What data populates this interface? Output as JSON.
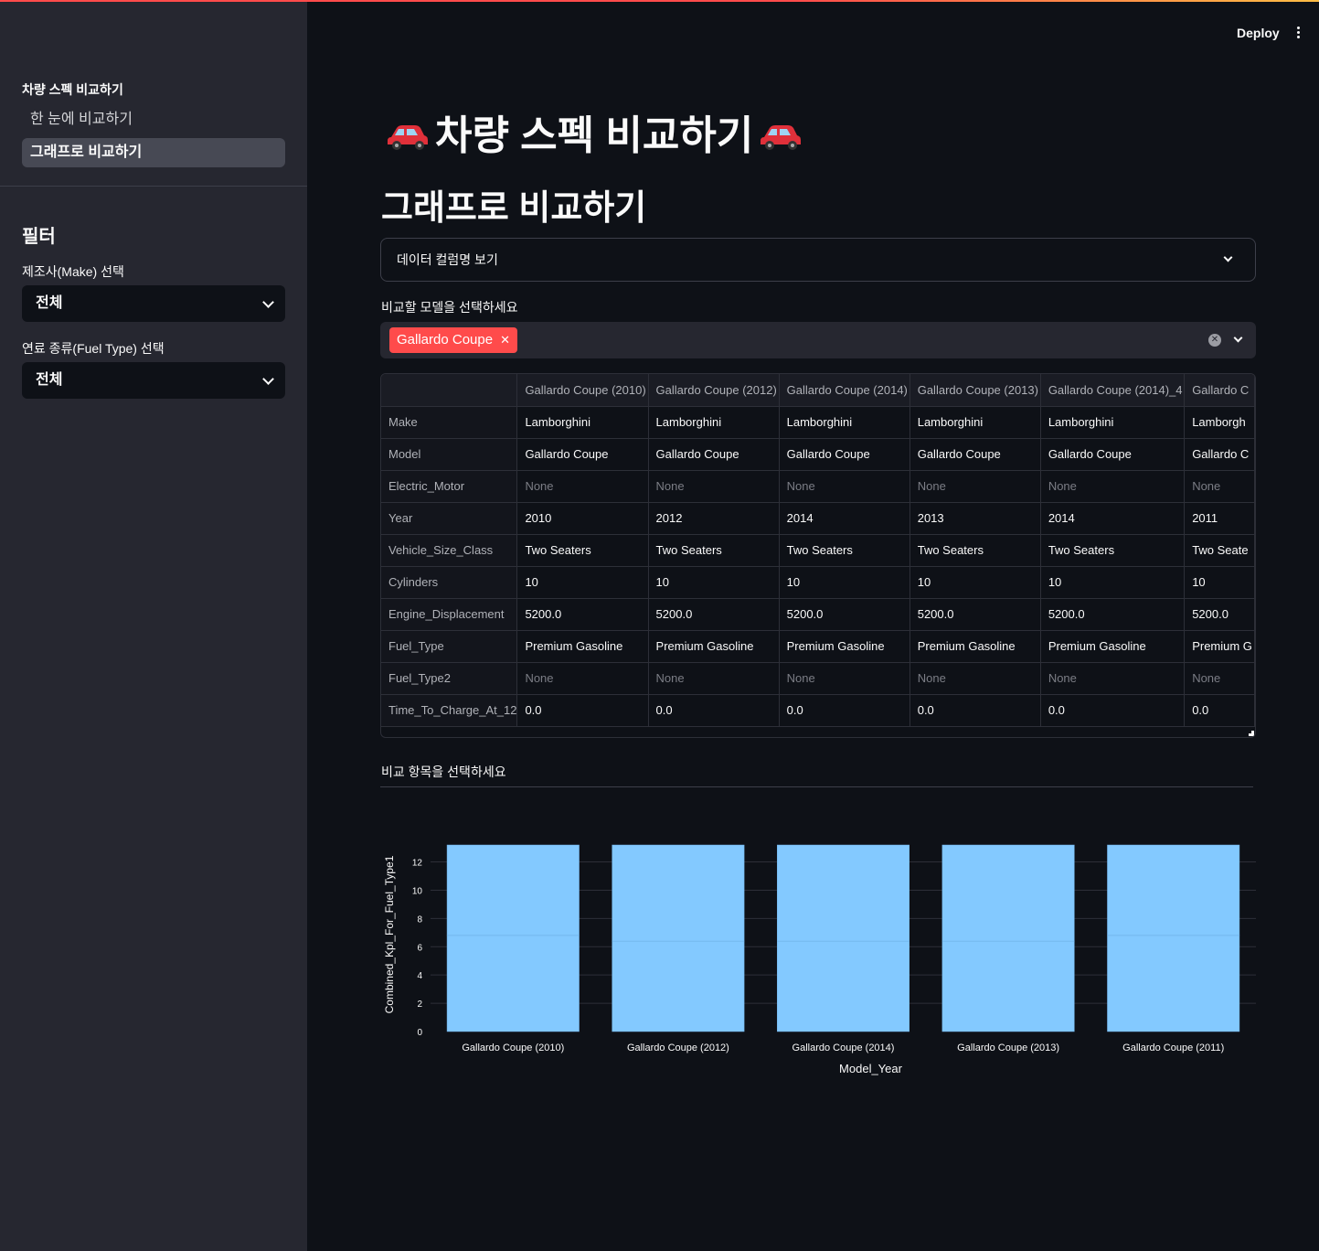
{
  "header": {
    "deploy_label": "Deploy"
  },
  "sidebar": {
    "nav_title": "차량 스펙 비교하기",
    "nav_items": [
      {
        "label": "한 눈에 비교하기",
        "active": false
      },
      {
        "label": "그래프로 비교하기",
        "active": true
      }
    ],
    "filter_title": "필터",
    "make_label": "제조사(Make) 선택",
    "make_value": "전체",
    "fuel_label": "연료 종류(Fuel Type) 선택",
    "fuel_value": "전체"
  },
  "main": {
    "title": "차량 스펙 비교하기",
    "subtitle": "그래프로 비교하기",
    "expander_label": "데이터 컬럼명 보기",
    "model_select_label": "비교할 모델을 선택하세요",
    "selected_tag": "Gallardo Coupe",
    "compare_label": "비교 항목을 선택하세요"
  },
  "table": {
    "columns": [
      "",
      "Gallardo Coupe (2010)",
      "Gallardo Coupe (2012)",
      "Gallardo Coupe (2014)",
      "Gallardo Coupe (2013)",
      "Gallardo Coupe (2014)_4",
      "Gallardo C"
    ],
    "rows": [
      [
        "Make",
        "Lamborghini",
        "Lamborghini",
        "Lamborghini",
        "Lamborghini",
        "Lamborghini",
        "Lamborgh"
      ],
      [
        "Model",
        "Gallardo Coupe",
        "Gallardo Coupe",
        "Gallardo Coupe",
        "Gallardo Coupe",
        "Gallardo Coupe",
        "Gallardo C"
      ],
      [
        "Electric_Motor",
        "None",
        "None",
        "None",
        "None",
        "None",
        "None"
      ],
      [
        "Year",
        "2010",
        "2012",
        "2014",
        "2013",
        "2014",
        "2011"
      ],
      [
        "Vehicle_Size_Class",
        "Two Seaters",
        "Two Seaters",
        "Two Seaters",
        "Two Seaters",
        "Two Seaters",
        "Two Seate"
      ],
      [
        "Cylinders",
        "10",
        "10",
        "10",
        "10",
        "10",
        "10"
      ],
      [
        "Engine_Displacement",
        "5200.0",
        "5200.0",
        "5200.0",
        "5200.0",
        "5200.0",
        "5200.0"
      ],
      [
        "Fuel_Type",
        "Premium Gasoline",
        "Premium Gasoline",
        "Premium Gasoline",
        "Premium Gasoline",
        "Premium Gasoline",
        "Premium G"
      ],
      [
        "Fuel_Type2",
        "None",
        "None",
        "None",
        "None",
        "None",
        "None"
      ],
      [
        "Time_To_Charge_At_12",
        "0.0",
        "0.0",
        "0.0",
        "0.0",
        "0.0",
        "0.0"
      ]
    ]
  },
  "chart_data": {
    "type": "bar",
    "barmode": "stack",
    "categories": [
      "Gallardo Coupe (2010)",
      "Gallardo Coupe (2012)",
      "Gallardo Coupe (2014)",
      "Gallardo Coupe (2013)",
      "Gallardo Coupe (2011)"
    ],
    "series": [
      {
        "values": [
          6.8,
          6.4,
          6.4,
          6.4,
          6.8
        ]
      },
      {
        "values": [
          6.4,
          6.8,
          6.8,
          6.8,
          6.4
        ]
      }
    ],
    "xlabel": "Model_Year",
    "ylabel": "Combined_Kpl_For_Fuel_Type1",
    "yticks": [
      0,
      2,
      4,
      6,
      8,
      10,
      12
    ],
    "ylim": [
      0,
      13.2
    ],
    "bar_color": "#83c9ff",
    "grid": true
  }
}
